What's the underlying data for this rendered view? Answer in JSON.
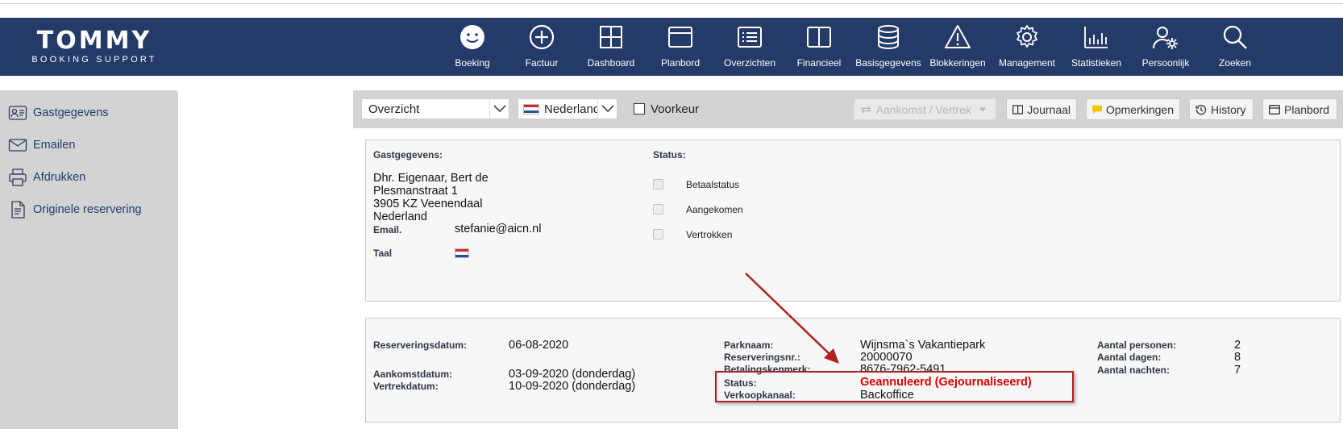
{
  "logo": {
    "main": "TOMMY",
    "sub": "BOOKING SUPPORT"
  },
  "nav": [
    {
      "label": "Boeking",
      "icon": "smiley-icon"
    },
    {
      "label": "Factuur",
      "icon": "plus-circle-icon"
    },
    {
      "label": "Dashboard",
      "icon": "grid-icon"
    },
    {
      "label": "Planbord",
      "icon": "window-icon"
    },
    {
      "label": "Overzichten",
      "icon": "list-icon"
    },
    {
      "label": "Financieel",
      "icon": "columns-icon"
    },
    {
      "label": "Basisgegevens",
      "icon": "database-icon"
    },
    {
      "label": "Blokkeringen",
      "icon": "warning-icon"
    },
    {
      "label": "Management",
      "icon": "gear-icon"
    },
    {
      "label": "Statistieken",
      "icon": "bar-chart-icon"
    },
    {
      "label": "Persoonlijk",
      "icon": "user-gear-icon"
    },
    {
      "label": "Zoeken",
      "icon": "search-icon"
    }
  ],
  "sidebar": {
    "items": [
      {
        "label": "Gastgegevens",
        "icon": "id-card-icon"
      },
      {
        "label": "Emailen",
        "icon": "envelope-icon"
      },
      {
        "label": "Afdrukken",
        "icon": "printer-icon"
      },
      {
        "label": "Originele reservering",
        "icon": "document-icon"
      }
    ]
  },
  "toolbar": {
    "view_select": "Overzicht",
    "language_select": "Nederlands",
    "preference_label": "Voorkeur",
    "buttons": {
      "arrival_departure": "Aankomst / Vertrek",
      "journal": "Journaal",
      "remarks": "Opmerkingen",
      "history": "History",
      "planbord": "Planbord"
    }
  },
  "guest": {
    "section_label": "Gastgegevens:",
    "name": "Dhr. Eigenaar, Bert de",
    "street": "Plesmanstraat 1",
    "city": "3905 KZ Veenendaal",
    "country": "Nederland",
    "email_label": "Email.",
    "email": "stefanie@aicn.nl",
    "language_label": "Taal"
  },
  "status": {
    "section_label": "Status:",
    "items": [
      "Betaalstatus",
      "Aangekomen",
      "Vertrokken"
    ]
  },
  "reservation": {
    "reservation_date_label": "Reserveringsdatum:",
    "reservation_date": "06-08-2020",
    "arrival_label": "Aankomstdatum:",
    "arrival": "03-09-2020 (donderdag)",
    "departure_label": "Vertrekdatum:",
    "departure": "10-09-2020 (donderdag)",
    "park_label": "Parknaam:",
    "park": "Wijnsma`s Vakantiepark",
    "reservation_nr_label": "Reserveringsnr.:",
    "reservation_nr": "20000070",
    "payment_ref_label": "Betalingskenmerk:",
    "payment_ref": "8676-7962-5491",
    "status_label": "Status:",
    "status": "Geannuleerd (Gejournaliseerd)",
    "channel_label": "Verkoopkanaal:",
    "channel": "Backoffice",
    "persons_label": "Aantal personen:",
    "persons": "2",
    "days_label": "Aantal dagen:",
    "days": "8",
    "nights_label": "Aantal nachten:",
    "nights": "7"
  },
  "colors": {
    "header": "#243a69",
    "sidebar": "#d3d3d3",
    "status_red": "#e00000",
    "highlight": "#b02020"
  }
}
